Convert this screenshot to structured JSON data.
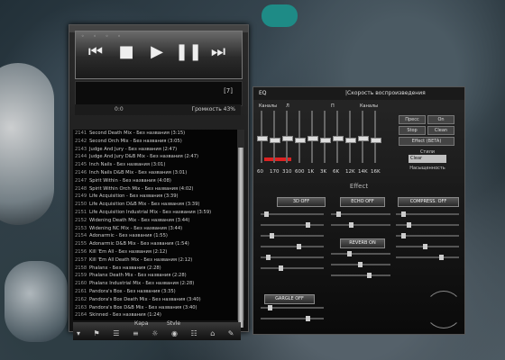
{
  "player": {
    "tag": "[7]",
    "time": "0:0",
    "volume_label": "Громкость 43%",
    "bottom_labels": {
      "left": "Кара",
      "right": "Stvle"
    },
    "tracks": [
      {
        "num": "2141",
        "title": "Second Death Mix - Без названия (3:15)"
      },
      {
        "num": "2142",
        "title": "Second Orch Mix - Без названия (3:05)"
      },
      {
        "num": "2143",
        "title": "Judge And Jury - Без названия (2:47)"
      },
      {
        "num": "2144",
        "title": "Judge And Jury D&B Mix - Без названия (2:47)"
      },
      {
        "num": "2145",
        "title": "Inch Nails - Без названия (3:01)"
      },
      {
        "num": "2146",
        "title": "Inch Nails D&B Mix - Без названия (3:01)"
      },
      {
        "num": "2147",
        "title": "Spirit Within - Без названия (4:08)"
      },
      {
        "num": "2148",
        "title": "Spirit Within Orch Mix - Без названия (4:02)"
      },
      {
        "num": "2149",
        "title": "Life Acquisition - Без названия (3:39)"
      },
      {
        "num": "2150",
        "title": "Life Acquisition D&B Mix - Без названия (3:39)"
      },
      {
        "num": "2151",
        "title": "Life Acquisition Industrial Mix - Без названия (3:59)"
      },
      {
        "num": "2152",
        "title": "Widening Death Mix - Без названия (3:44)"
      },
      {
        "num": "2153",
        "title": "Widening NC Mix - Без названия (3:44)"
      },
      {
        "num": "2154",
        "title": "Adonarmic - Без названия (1:55)"
      },
      {
        "num": "2155",
        "title": "Adonarmic D&B Mix - Без названия (1:54)"
      },
      {
        "num": "2156",
        "title": "Kill 'Em All - Без названия (2:12)"
      },
      {
        "num": "2157",
        "title": "Kill 'Em All Death Mix - Без названия (2:12)"
      },
      {
        "num": "2158",
        "title": "Phalanx - Без названия (2:28)"
      },
      {
        "num": "2159",
        "title": "Phalanx Death Mix - Без названия (2:28)"
      },
      {
        "num": "2160",
        "title": "Phalanx Industrial Mix - Без названия (2:28)"
      },
      {
        "num": "2161",
        "title": "Pandora's Box - Без названия (3:35)"
      },
      {
        "num": "2162",
        "title": "Pandora's Box Death Mix - Без названия (3:40)"
      },
      {
        "num": "2163",
        "title": "Pandora's Box D&B Mix - Без названия (3:40)"
      },
      {
        "num": "2164",
        "title": "Skinned - Без названия (1:24)"
      },
      {
        "num": "2165",
        "title": "Skinned D&B Mix - Без названия (1:28)"
      },
      {
        "num": "2166",
        "title": "The Truth - Без названия (3:25)",
        "active": true
      },
      {
        "num": "2167",
        "title": "The Truth Guitar Mix - Без названия (3:25)"
      }
    ]
  },
  "eq": {
    "title": "EQ",
    "speed_label": "|Скорость воспроизведения",
    "channels_left": "Каналы",
    "channels_l": "Л",
    "channels_p": "П",
    "channels_right": "Каналы",
    "freqs": [
      "60",
      "170",
      "310",
      "600",
      "1K",
      "3K",
      "6K",
      "12K",
      "14K",
      "16K"
    ],
    "side": {
      "preset": "Пресс",
      "on": "On",
      "stop": "Stop",
      "clean": "Clean",
      "effect_beta": "Effect (BETA)",
      "style_label": "Стили",
      "style_value": "Clear",
      "saturation_label": "Насыщенность"
    }
  },
  "effect": {
    "title": "Effect",
    "btn_3d": "3D OFF",
    "btn_echo": "ECHO OFF",
    "btn_compress": "COMPRESS. OFF",
    "btn_reverb": "REVERB ON",
    "btn_gargle": "GARGLE OFF"
  }
}
